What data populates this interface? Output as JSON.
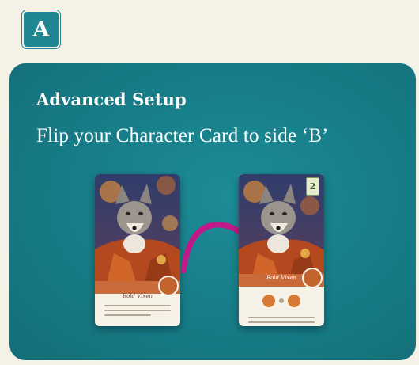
{
  "badge": {
    "letter": "A"
  },
  "panel": {
    "title": "Advanced Setup",
    "subtitle": "Flip your Character Card to side ‘B’"
  },
  "cards": {
    "front": {
      "name": "Bold Vixen"
    },
    "back": {
      "name": "Bold Vixen",
      "side_label": "2"
    }
  },
  "colors": {
    "panel": "#177d88",
    "badge": "#1e8791",
    "arrow": "#c2198a",
    "background": "#f4f1e6",
    "card_accent": "#c96a3a"
  },
  "icons": {
    "arrow": "curved-flip-arrow-icon",
    "token": "leaf-token-icon"
  }
}
